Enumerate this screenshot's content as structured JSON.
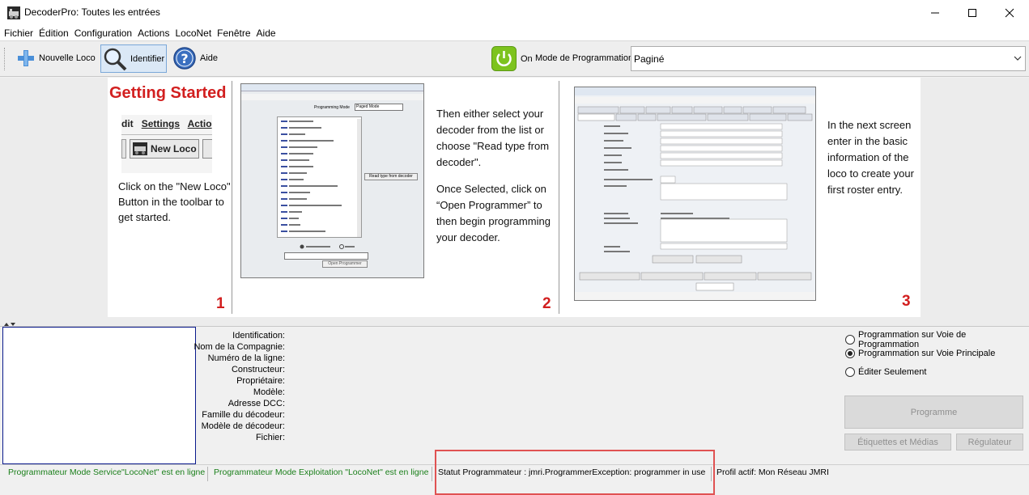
{
  "window": {
    "title": "DecoderPro: Toutes les entrées"
  },
  "menu": [
    "Fichier",
    "Édition",
    "Configuration",
    "Actions",
    "LocoNet",
    "Fenêtre",
    "Aide"
  ],
  "toolbar": {
    "new_loco": "Nouvelle Loco",
    "identify": "Identifier",
    "help": "Aide",
    "power": "On",
    "mode_label": "Mode de Programmation",
    "mode_value": "Paginé"
  },
  "getting_started": {
    "title": "Getting Started",
    "step1": {
      "number": "1",
      "text": "Click on the \"New Loco\" Button in the toolbar to get started.",
      "crop_menu": [
        "dit",
        "Settings",
        "Actio"
      ],
      "crop_button": "New Loco"
    },
    "step2": {
      "number": "2",
      "text1": "Then either select your decoder from the list or choose \"Read type from decoder\".",
      "text2": "Once Selected, click on “Open Programmer” to then begin programming your decoder.",
      "shot_mode_label": "Programming Mode",
      "shot_mode_value": "Paged Mode",
      "shot_read_btn": "Read type from decoder",
      "shot_open_btn": "Open Programmer"
    },
    "step3": {
      "number": "3",
      "text": "In the next screen enter in the basic information of the loco to create your first roster entry."
    }
  },
  "details": {
    "labels": [
      "Identification:",
      "Nom de la Compagnie:",
      "Numéro de la ligne:",
      "Constructeur:",
      "Propriétaire:",
      "Modèle:",
      "Adresse DCC:",
      "Famille du décodeur:",
      "Modèle de décodeur:",
      "Fichier:"
    ],
    "radios": [
      {
        "label": "Programmation sur Voie de Programmation",
        "selected": false
      },
      {
        "label": "Programmation sur Voie Principale",
        "selected": true
      },
      {
        "label": "Éditer Seulement",
        "selected": false
      }
    ],
    "program_btn": "Programme",
    "labels_btn": "Étiquettes et Médias",
    "throttle_btn": "Régulateur"
  },
  "status": {
    "service": "Programmateur Mode Service\"LocoNet\" est en ligne",
    "ops": "Programmateur Mode Exploitation \"LocoNet\" est en ligne",
    "prog_status": "Statut Programmateur :  jmri.ProgrammerException: programmer in use",
    "profile": "Profil actif: Mon Réseau JMRI"
  },
  "colors": {
    "accent_red": "#d21f1f",
    "online_green": "#1a7f1a",
    "power_green": "#7dc31e",
    "highlight": "#e05252"
  }
}
